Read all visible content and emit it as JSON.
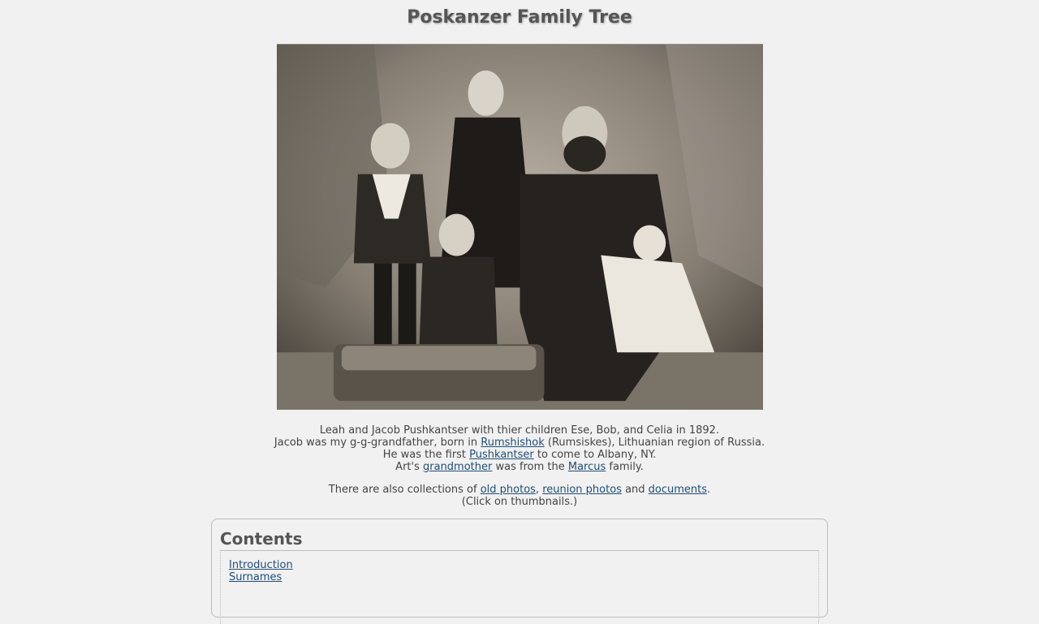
{
  "page": {
    "title": "Poskanzer Family Tree"
  },
  "caption": {
    "line1": "Leah and Jacob Pushkantser with thier children Ese, Bob, and Celia in 1892.",
    "line2_pre": "Jacob was my g-g-grandfather, born in ",
    "line2_link": "Rumshishok",
    "line2_post": " (Rumsiskes), Lithuanian region of Russia.",
    "line3_pre": "He was the first ",
    "line3_link": "Pushkantser",
    "line3_post": " to come to Albany, NY.",
    "line4_pre": "Art's ",
    "line4_link1": "grandmother",
    "line4_mid": " was from the ",
    "line4_link2": "Marcus",
    "line4_post": " family."
  },
  "collections": {
    "pre": "There are also collections of ",
    "link1": "old photos",
    "sep1": ", ",
    "link2": "reunion photos",
    "sep2": " and ",
    "link3": "documents",
    "end": ".",
    "hint": "(Click on thumbnails.)"
  },
  "contents": {
    "heading": "Contents",
    "items": [
      "Introduction",
      "Surnames"
    ]
  },
  "colors": {
    "background": "#f1f1f1",
    "link": "#1f4e79",
    "text": "#444444"
  }
}
